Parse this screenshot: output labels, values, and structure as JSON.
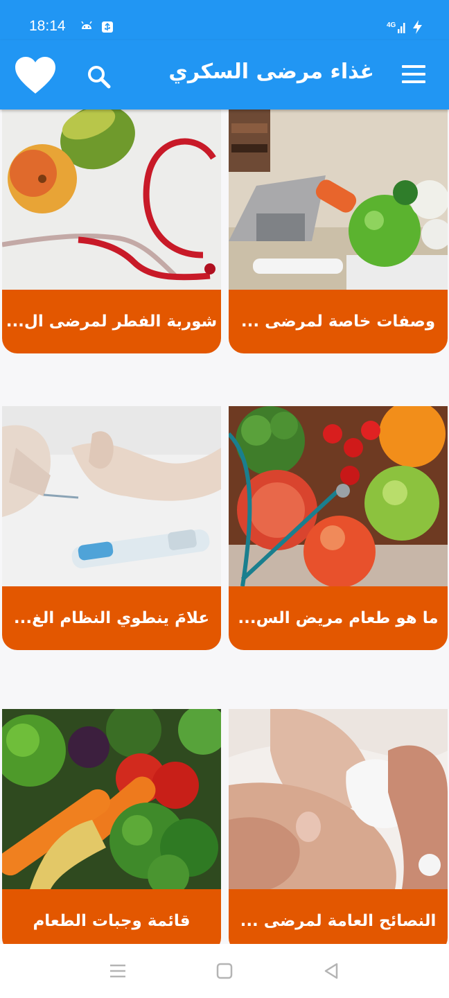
{
  "status_bar": {
    "time": "18:14",
    "network": "4G",
    "icons": [
      "android-debug-icon",
      "usb-icon",
      "signal-icon",
      "charging-icon"
    ]
  },
  "app_bar": {
    "title": "غذاء مرضى السكري",
    "icons": [
      "menu-icon",
      "search-icon",
      "heart-icon"
    ],
    "color": "#2196f3"
  },
  "cards": [
    {
      "label": "وصفات خاصة لمرضى ...",
      "image": "fruit-and-glucose-meter"
    },
    {
      "label": "شوربة الفطر لمرضى ال...",
      "image": "apple-avocado-stethoscope"
    },
    {
      "label": "ما هو طعام مريض الس...",
      "image": "fruit-bowl-stethoscope"
    },
    {
      "label": "علامَ ينطوي النظام الغ...",
      "image": "blood-glucose-finger-test"
    },
    {
      "label": "النصائح العامة لمرضى ...",
      "image": "hands-wound-care"
    },
    {
      "label": "قائمة وجبات الطعام",
      "image": "vegetables-carrots-broccoli"
    }
  ],
  "accent_color": "#e35700",
  "nav_bar": {
    "buttons": [
      "recents-button",
      "home-button",
      "back-button"
    ]
  }
}
